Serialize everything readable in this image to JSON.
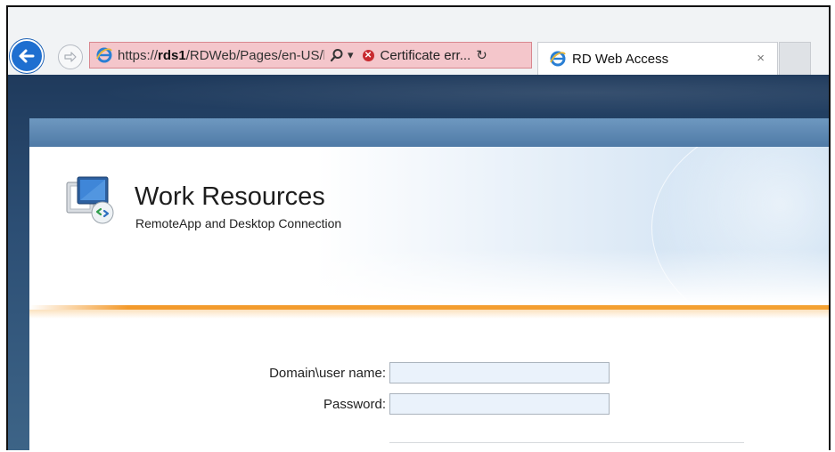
{
  "browser": {
    "address": {
      "url_prefix": "https://",
      "url_host": "rds1",
      "url_path": "/RDWeb/Pages/en-US/l",
      "search_dropdown_glyph": "▾",
      "certificate_error": "Certificate err...",
      "icons": [
        "ie-icon",
        "search-icon",
        "error-icon",
        "refresh-icon"
      ]
    },
    "tab": {
      "title": "RD Web Access",
      "close_glyph": "×"
    },
    "nav_icons": [
      "back-arrow-icon",
      "forward-arrow-icon"
    ]
  },
  "page": {
    "title": "Work Resources",
    "subtitle": "RemoteApp and Desktop Connection",
    "form": {
      "username_label": "Domain\\user name:",
      "username_value": "",
      "password_label": "Password:",
      "password_value": ""
    }
  },
  "colors": {
    "address_error_bg": "#f4c6cb",
    "back_button": "#1f6fd0",
    "accent_orange": "#f39a2c",
    "header_blue": "#4f7aa6"
  }
}
